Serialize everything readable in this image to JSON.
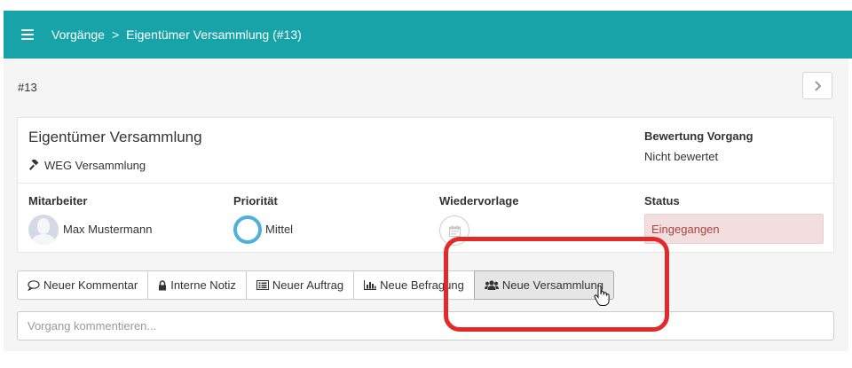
{
  "colors": {
    "header_bg": "#17a3a8",
    "status_bg": "#f2dede",
    "status_text": "#a94442",
    "priority_ring": "#4fb0d8",
    "highlight": "#e32a2a"
  },
  "header": {
    "menu_icon": "hamburger-icon",
    "breadcrumb": {
      "root": "Vorgänge",
      "separator": ">",
      "current": "Eigentümer Versammlung (#13)"
    }
  },
  "case": {
    "id": "#13",
    "next_icon": "chevron-right-icon"
  },
  "card": {
    "title": "Eigentümer Versammlung",
    "subtitle_icon": "gavel-icon",
    "subtitle": "WEG Versammlung",
    "rating_label": "Bewertung Vorgang",
    "rating_value": "Nicht bewertet",
    "fields": {
      "employee_label": "Mitarbeiter",
      "employee_name": "Max Mustermann",
      "priority_label": "Priorität",
      "priority_value": "Mittel",
      "followup_label": "Wiedervorlage",
      "followup_icon": "calendar-icon",
      "status_label": "Status",
      "status_value": "Eingegangen"
    }
  },
  "actions": [
    {
      "label": "Neuer Kommentar",
      "icon": "comment-icon"
    },
    {
      "label": "Interne Notiz",
      "icon": "lock-icon"
    },
    {
      "label": "Neuer Auftrag",
      "icon": "list-icon"
    },
    {
      "label": "Neue Befragung",
      "icon": "bar-chart-icon"
    },
    {
      "label": "Neue Versammlung",
      "icon": "users-icon"
    }
  ],
  "comment": {
    "placeholder": "Vorgang kommentieren..."
  }
}
